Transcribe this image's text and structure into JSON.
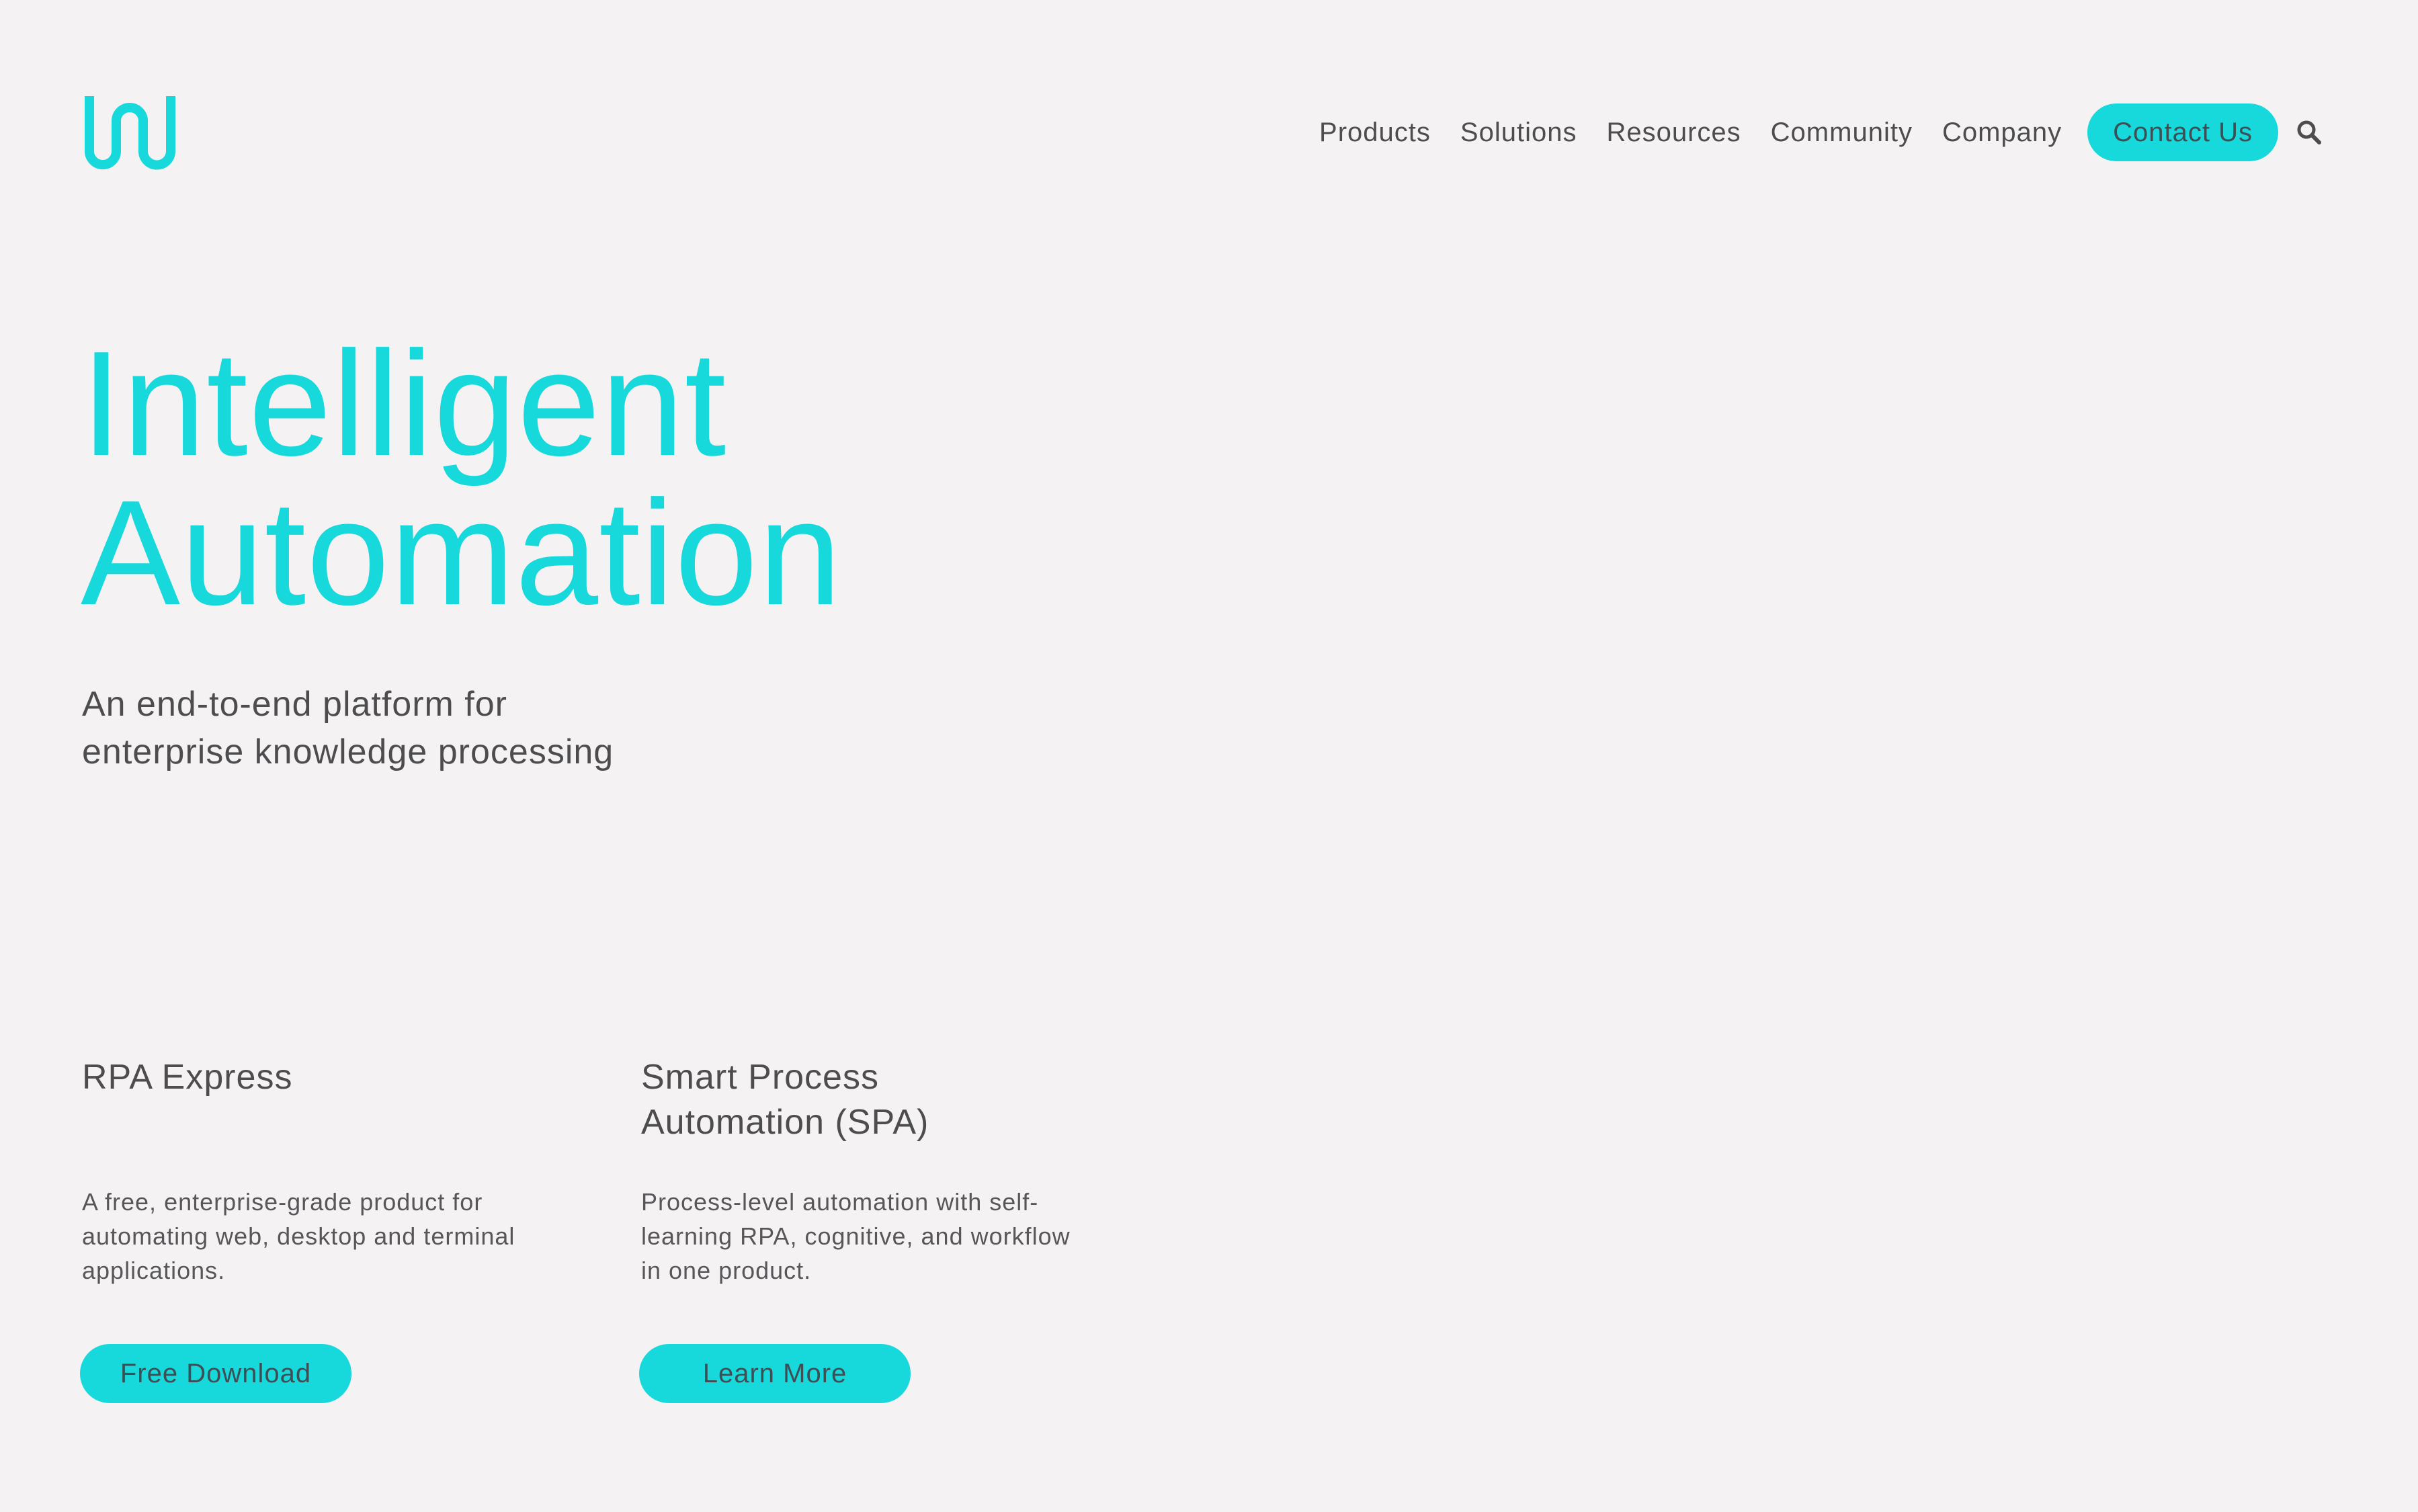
{
  "brand": {
    "logo_icon": "wave-w-logo-icon",
    "accent_color": "#17d8db",
    "text_color": "#4d4d4f",
    "background_color": "#f4f2f3"
  },
  "nav": {
    "items": [
      {
        "label": "Products"
      },
      {
        "label": "Solutions"
      },
      {
        "label": "Resources"
      },
      {
        "label": "Community"
      },
      {
        "label": "Company"
      }
    ],
    "contact_label": "Contact Us",
    "search_icon": "search-icon"
  },
  "hero": {
    "title_line1": "Intelligent",
    "title_line2": "Automation",
    "subtitle_line1": "An end-to-end platform for",
    "subtitle_line2": "enterprise knowledge processing"
  },
  "products": [
    {
      "title_line1": "RPA Express",
      "title_line2": "",
      "desc_line1": "A free, enterprise-grade product for",
      "desc_line2": "automating web, desktop and terminal",
      "desc_line3": "applications.",
      "button_label": "Free Download"
    },
    {
      "title_line1": "Smart Process",
      "title_line2": "Automation (SPA)",
      "desc_line1": "Process-level automation with self-",
      "desc_line2": "learning RPA, cognitive, and workflow",
      "desc_line3": "in one product.",
      "button_label": "Learn More"
    }
  ]
}
